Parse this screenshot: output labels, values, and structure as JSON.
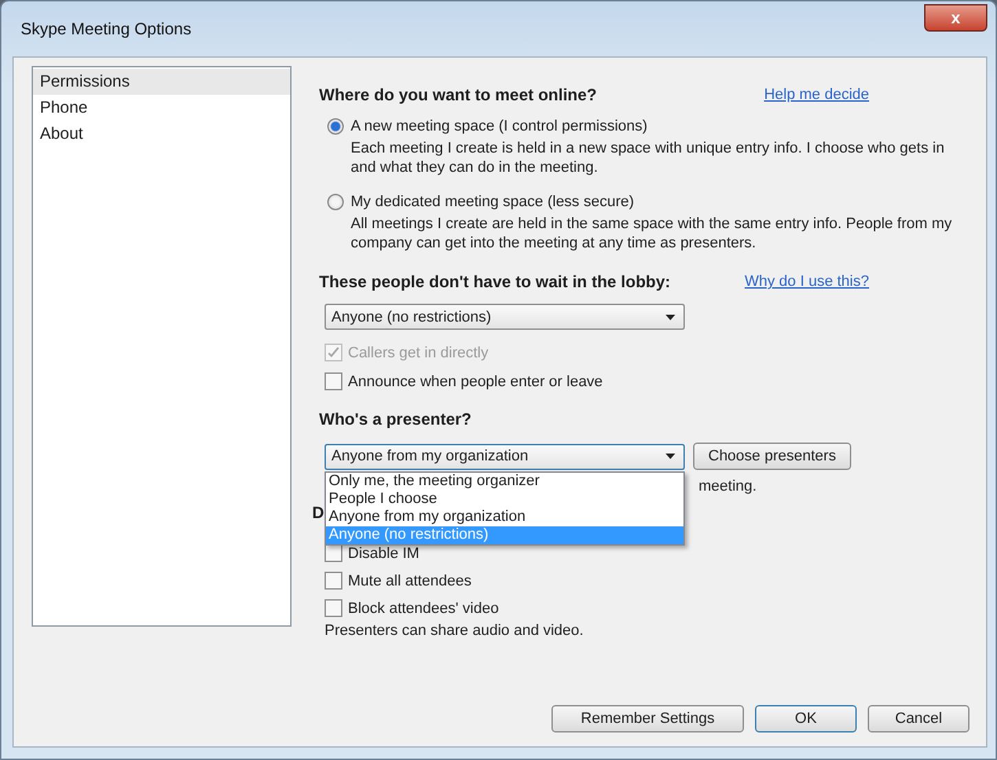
{
  "window": {
    "title": "Skype Meeting Options",
    "close": "x"
  },
  "sidebar": {
    "items": [
      {
        "label": "Permissions",
        "selected": true
      },
      {
        "label": "Phone",
        "selected": false
      },
      {
        "label": "About",
        "selected": false
      }
    ]
  },
  "meet": {
    "heading": "Where do you want to meet online?",
    "link": "Help me decide",
    "options": [
      {
        "label": "A new meeting space (I control permissions)",
        "selected": true,
        "description": "Each meeting I create is held in a new space with unique entry info. I choose who gets in and what they can do in the meeting."
      },
      {
        "label": "My dedicated meeting space (less secure)",
        "selected": false,
        "description": "All meetings I create are held in the same space with the same entry info. People from my company can get into the meeting at any time as presenters."
      }
    ]
  },
  "lobby": {
    "heading": "These people don't have to wait in the lobby:",
    "link": "Why do I use this?",
    "select": "Anyone (no restrictions)",
    "checkboxes": [
      {
        "label": "Callers get in directly",
        "checked": true,
        "disabled": true
      },
      {
        "label": "Announce when people enter or leave",
        "checked": false,
        "disabled": false
      }
    ]
  },
  "presenter": {
    "heading": "Who's a presenter?",
    "select": "Anyone from my organization",
    "button": "Choose presenters",
    "note": "meeting.",
    "dropdown": [
      {
        "label": "Only me, the meeting organizer",
        "selected": false
      },
      {
        "label": "People I choose",
        "selected": false
      },
      {
        "label": "Anyone from my organization",
        "selected": false
      },
      {
        "label": "Anyone (no restrictions)",
        "selected": true
      }
    ]
  },
  "participation": {
    "heading": "D",
    "checkboxes": [
      {
        "label": "Disable IM",
        "checked": false,
        "disabled": false
      },
      {
        "label": "Mute all attendees",
        "checked": false,
        "disabled": false
      },
      {
        "label": "Block attendees' video",
        "checked": false,
        "disabled": false
      }
    ],
    "note": "Presenters can share audio and video."
  },
  "buttons": [
    {
      "label": "Remember Settings",
      "default": false
    },
    {
      "label": "OK",
      "default": true
    },
    {
      "label": "Cancel",
      "default": false
    }
  ]
}
